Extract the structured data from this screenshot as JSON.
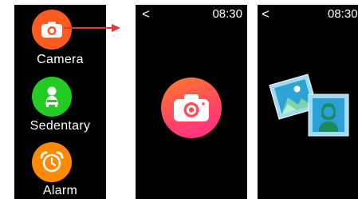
{
  "menu": {
    "items": [
      {
        "label": "Camera",
        "icon": "camera-icon",
        "color": "#ff5a1f"
      },
      {
        "label": "Sedentary",
        "icon": "sedentary-person-icon",
        "color": "#22cc22"
      },
      {
        "label": "Alarm",
        "icon": "alarm-clock-icon",
        "color": "#ff8a00"
      }
    ]
  },
  "camera_screen": {
    "back": "<",
    "time": "08:30",
    "icon": "camera-icon",
    "gradient": [
      "#ff7a2a",
      "#ff2d8c"
    ]
  },
  "gallery_screen": {
    "back": "<",
    "time": "08:30",
    "icons": [
      "landscape-photo-icon",
      "portrait-photo-icon"
    ]
  },
  "colors": {
    "arrow": "#e53935",
    "photo_frame": "#9fdcf2",
    "photo_inner": "#2ea3d6",
    "portrait_bg": "#2a9fd8",
    "portrait_person": "#1c8a5a"
  }
}
